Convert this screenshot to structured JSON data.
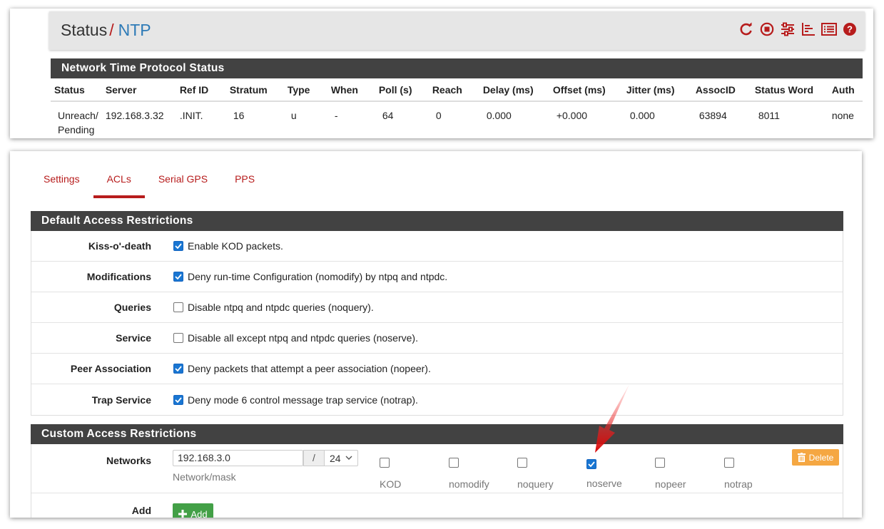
{
  "header": {
    "crumb_status": "Status",
    "crumb_sep": "/",
    "crumb_ntp": "NTP",
    "icons": [
      "restart-icon",
      "stop-icon",
      "settings-sliders-icon",
      "chart-icon",
      "log-list-icon",
      "help-icon"
    ],
    "accent": "#b71c1c"
  },
  "status_panel": {
    "title": "Network Time Protocol Status",
    "columns": [
      "Status",
      "Server",
      "Ref ID",
      "Stratum",
      "Type",
      "When",
      "Poll (s)",
      "Reach",
      "Delay (ms)",
      "Offset (ms)",
      "Jitter (ms)",
      "AssocID",
      "Status Word",
      "Auth"
    ],
    "row": {
      "status_line1": "Unreach/",
      "status_line2": "Pending",
      "server": "192.168.3.32",
      "refid": ".INIT.",
      "stratum": "16",
      "type": "u",
      "when": "-",
      "poll": "64",
      "reach": "0",
      "delay": "0.000",
      "offset": "+0.000",
      "jitter": "0.000",
      "associd": "63894",
      "statusword": "8011",
      "auth": "none"
    }
  },
  "tabs": {
    "settings": "Settings",
    "acls": "ACLs",
    "serial_gps": "Serial GPS",
    "pps": "PPS",
    "active": "ACLs"
  },
  "default_acl": {
    "title": "Default Access Restrictions",
    "rows": [
      {
        "label": "Kiss-o'-death",
        "text": "Enable KOD packets.",
        "checked": true
      },
      {
        "label": "Modifications",
        "text": "Deny run-time Configuration (nomodify) by ntpq and ntpdc.",
        "checked": true
      },
      {
        "label": "Queries",
        "text": "Disable ntpq and ntpdc queries (noquery).",
        "checked": false
      },
      {
        "label": "Service",
        "text": "Disable all except ntpq and ntpdc queries (noserve).",
        "checked": false
      },
      {
        "label": "Peer Association",
        "text": "Deny packets that attempt a peer association (nopeer).",
        "checked": true
      },
      {
        "label": "Trap Service",
        "text": "Deny mode 6 control message trap service (notrap).",
        "checked": true
      }
    ]
  },
  "custom_acl": {
    "title": "Custom Access Restrictions",
    "networks_label": "Networks",
    "network_value": "192.168.3.0",
    "slash": "/",
    "mask_value": "24",
    "help": "Network/mask",
    "options": [
      {
        "label": "KOD",
        "checked": false
      },
      {
        "label": "nomodify",
        "checked": false
      },
      {
        "label": "noquery",
        "checked": false
      },
      {
        "label": "noserve",
        "checked": true
      },
      {
        "label": "nopeer",
        "checked": false
      },
      {
        "label": "notrap",
        "checked": false
      }
    ],
    "delete_label": "Delete",
    "add_label": "Add",
    "add_button": "Add"
  }
}
